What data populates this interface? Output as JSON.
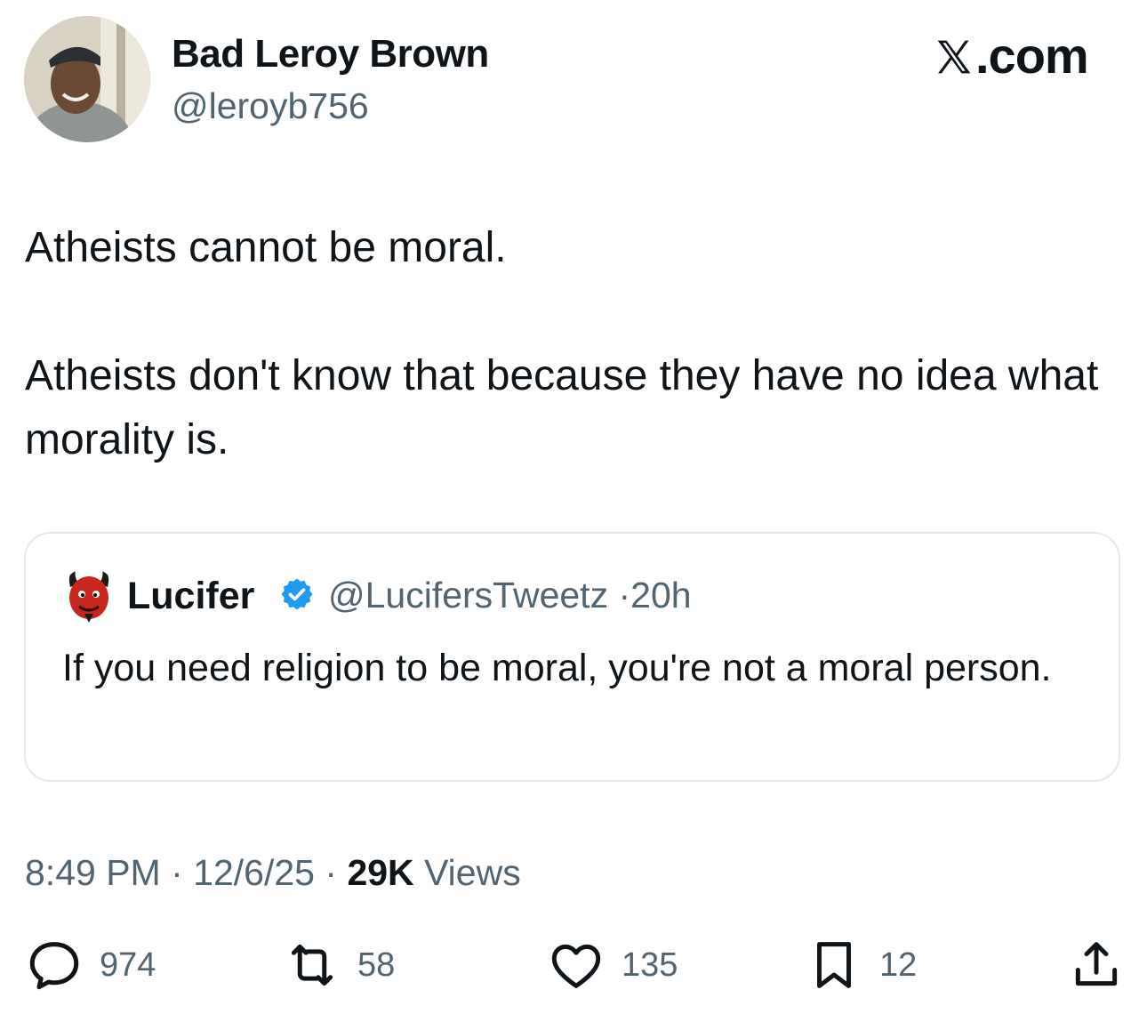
{
  "author": {
    "display_name": "Bad Leroy Brown",
    "handle": "@leroyb756"
  },
  "brand": {
    "label": ".com",
    "icon": "x-logo-icon"
  },
  "tweet": {
    "text": "Atheists cannot be moral.\n\nAtheists don't know that because they have no idea what morality is."
  },
  "quoted_tweet": {
    "display_name": "Lucifer",
    "verified_icon": "verified-badge-icon",
    "handle": "@LucifersTweetz",
    "separator": "·",
    "time_ago": "20h",
    "text": "If you need religion to be moral, you're not a moral person."
  },
  "meta": {
    "time": "8:49 PM",
    "sep1": "·",
    "date": "12/6/25",
    "sep2": "·",
    "views_count": "29K",
    "views_label": "Views"
  },
  "actions": {
    "replies": "974",
    "reposts": "58",
    "likes": "135",
    "bookmarks": "12"
  },
  "colors": {
    "text": "#0f1419",
    "secondary": "#536471",
    "border": "#e6e9ec",
    "verified": "#1d9bf0"
  }
}
